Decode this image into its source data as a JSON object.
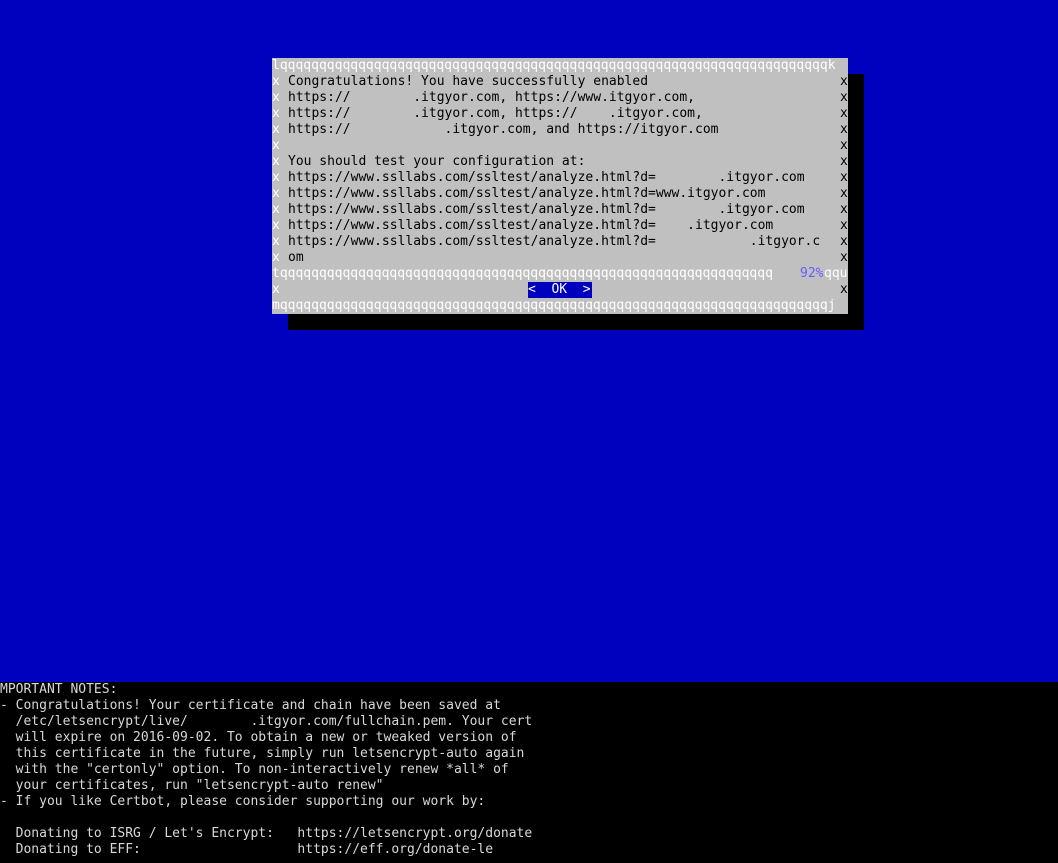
{
  "dialog": {
    "top_border": "lqqqqqqqqqqqqqqqqqqqqqqqqqqqqqqqqqqqqqqqqqqqqqqqqqqqqqqqqqqqqqqqqqqqqqqk",
    "sep_border": "tqqqqqqqqqqqqqqqqqqqqqqqqqqqqqqqqqqqqqqqqqqqqqqqqqqqqqqqqqqqqqqq",
    "bottom_border": "mqqqqqqqqqqqqqqqqqqqqqqqqqqqqqqqqqqqqqqqqqqqqqqqqqqqqqqqqqqqqqqqqqqqqqqj",
    "side_char": "x",
    "scroll_percent": "92%",
    "scroll_tail": "qqu",
    "lines": [
      "Congratulations! You have successfully enabled",
      "https://        .itgyor.com, https://www.itgyor.com,",
      "https://        .itgyor.com, https://    .itgyor.com,",
      "https://            .itgyor.com, and https://itgyor.com",
      "",
      "You should test your configuration at:",
      "https://www.ssllabs.com/ssltest/analyze.html?d=        .itgyor.com",
      "https://www.ssllabs.com/ssltest/analyze.html?d=www.itgyor.com",
      "https://www.ssllabs.com/ssltest/analyze.html?d=        .itgyor.com",
      "https://www.ssllabs.com/ssltest/analyze.html?d=    .itgyor.com",
      "https://www.ssllabs.com/ssltest/analyze.html?d=            .itgyor.c",
      "om"
    ],
    "ok_label": "<  OK  >"
  },
  "terminal": {
    "lines": [
      "MPORTANT NOTES:",
      "- Congratulations! Your certificate and chain have been saved at",
      "  /etc/letsencrypt/live/        .itgyor.com/fullchain.pem. Your cert",
      "  will expire on 2016-09-02. To obtain a new or tweaked version of",
      "  this certificate in the future, simply run letsencrypt-auto again",
      "  with the \"certonly\" option. To non-interactively renew *all* of",
      "  your certificates, run \"letsencrypt-auto renew\"",
      "- If you like Certbot, please consider supporting our work by:",
      "",
      "  Donating to ISRG / Let's Encrypt:   https://letsencrypt.org/donate",
      "  Donating to EFF:                    https://eff.org/donate-le"
    ]
  },
  "colors": {
    "screen_bg": "#0000bf",
    "dialog_bg": "#c0c0c0",
    "button_bg": "#0000bf",
    "terminal_bg": "#000000",
    "percent": "#6060ff"
  }
}
